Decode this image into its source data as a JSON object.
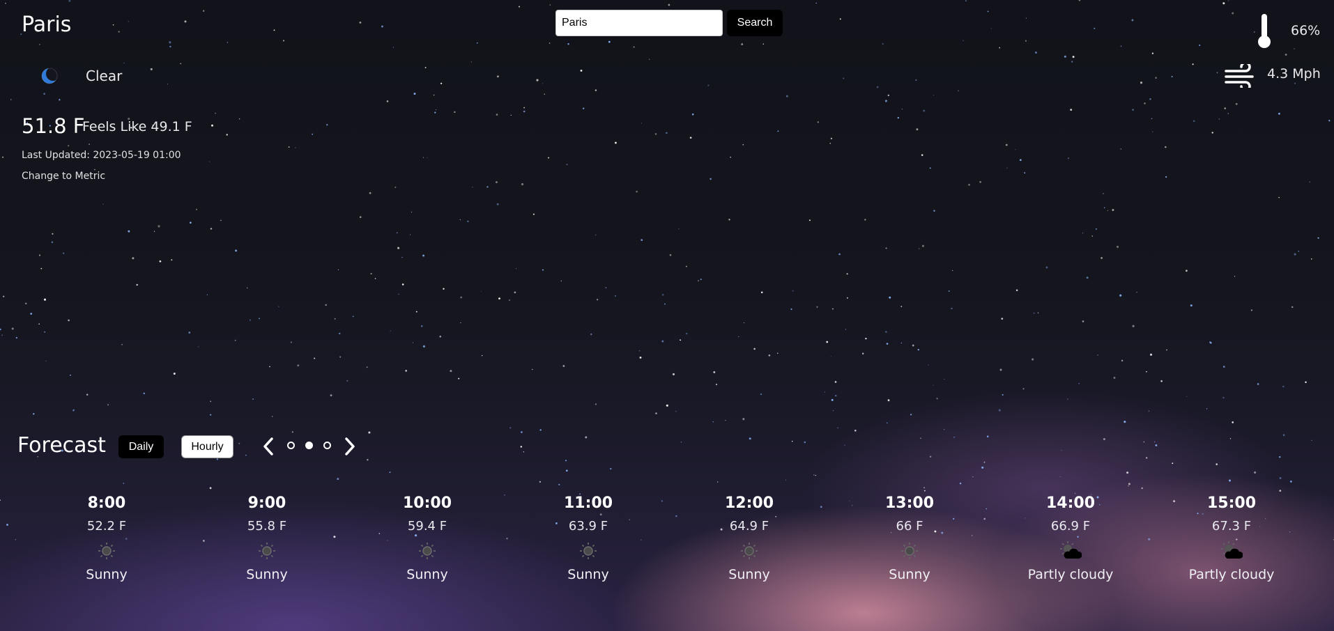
{
  "current": {
    "city": "Paris",
    "condition": "Clear",
    "condition_icon": "moon-icon",
    "temperature": "51.8 F",
    "feels_like": "Feels Like 49.1 F",
    "last_updated": "Last Updated: 2023-05-19 01:00",
    "unit_toggle": "Change to Metric"
  },
  "search": {
    "value": "Paris",
    "button_label": "Search"
  },
  "stats": {
    "humidity": "66%",
    "humidity_icon": "thermometer-icon",
    "wind": "4.3 Mph",
    "wind_icon": "wind-icon"
  },
  "forecast": {
    "title": "Forecast",
    "daily_label": "Daily",
    "hourly_label": "Hourly",
    "active_page": 2,
    "page_count": 3,
    "hours": [
      {
        "time": "8:00",
        "temp": "52.2 F",
        "icon": "sun-icon",
        "condition": "Sunny"
      },
      {
        "time": "9:00",
        "temp": "55.8 F",
        "icon": "sun-icon",
        "condition": "Sunny"
      },
      {
        "time": "10:00",
        "temp": "59.4 F",
        "icon": "sun-icon",
        "condition": "Sunny"
      },
      {
        "time": "11:00",
        "temp": "63.9 F",
        "icon": "sun-icon",
        "condition": "Sunny"
      },
      {
        "time": "12:00",
        "temp": "64.9 F",
        "icon": "sun-icon",
        "condition": "Sunny"
      },
      {
        "time": "13:00",
        "temp": "66 F",
        "icon": "sun-icon",
        "condition": "Sunny"
      },
      {
        "time": "14:00",
        "temp": "66.9 F",
        "icon": "partly-cloudy-icon",
        "condition": "Partly cloudy"
      },
      {
        "time": "15:00",
        "temp": "67.3 F",
        "icon": "partly-cloudy-icon",
        "condition": "Partly cloudy"
      }
    ]
  }
}
